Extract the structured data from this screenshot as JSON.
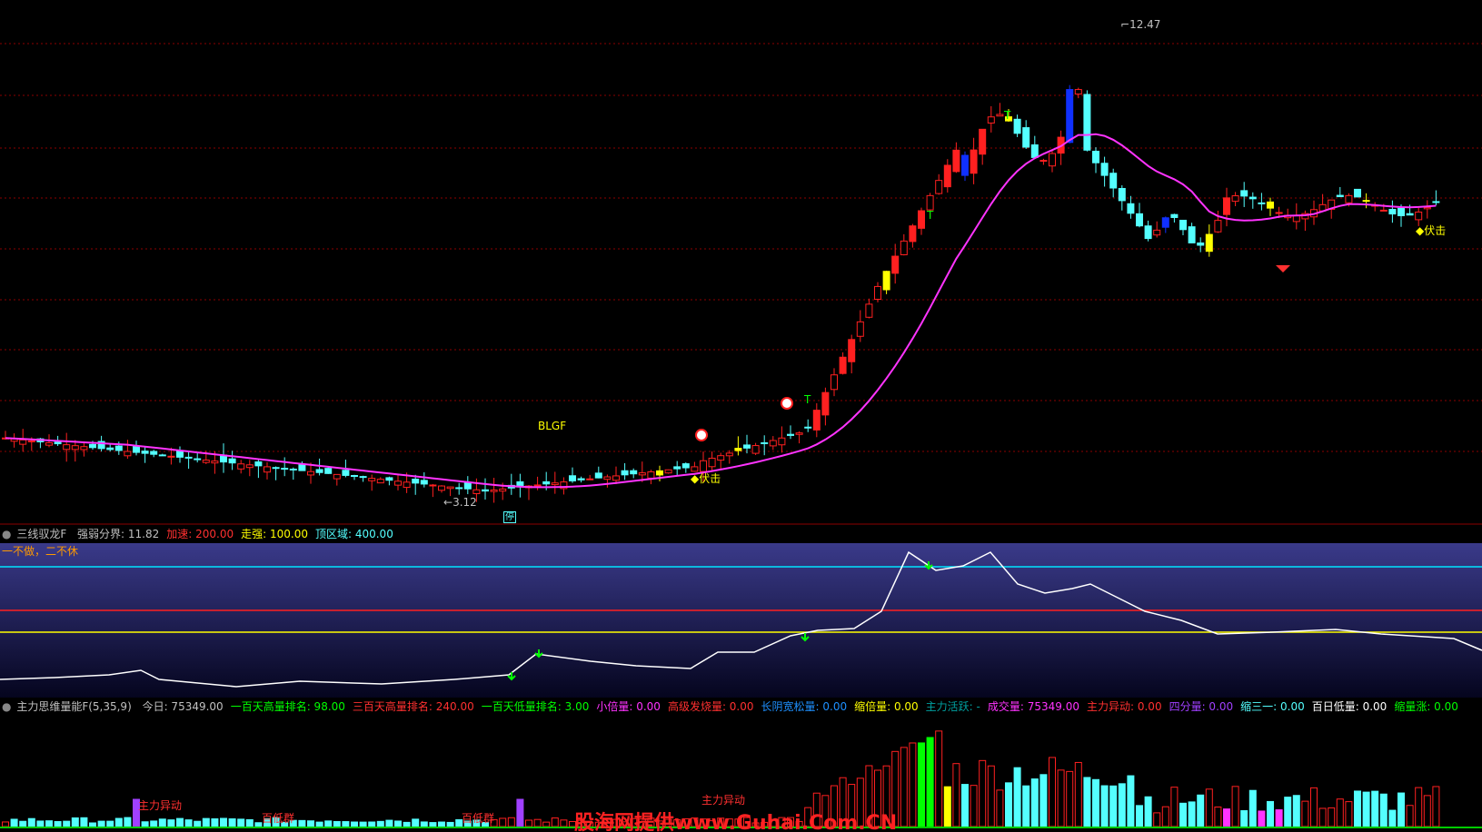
{
  "price_panel": {
    "high_label": "12.47",
    "low_label": "3.12",
    "signals": {
      "blgf": "BLGF",
      "fuji_1": "◆伏击",
      "fuji_2": "◆伏击",
      "t_1": "T",
      "t_2": "T",
      "t_3": "T",
      "mark_ting": "停"
    },
    "colors": {
      "ma_line": "#ff33ff",
      "up_candle": "#ff2020",
      "down_candle": "#54ffff",
      "yellow_candle": "#ffff00",
      "blue_candle": "#1030ff",
      "grid": "#8b0000"
    }
  },
  "oscillator": {
    "name": "三线驭龙F",
    "params": [
      {
        "label": "强弱分界: 11.82",
        "color": "#c0c0c0"
      },
      {
        "label": "加速: 200.00",
        "color": "#ff3030"
      },
      {
        "label": "走强: 100.00",
        "color": "#ffff00"
      },
      {
        "label": "顶区域: 400.00",
        "color": "#54ffff"
      }
    ],
    "note": "一不做，二不休",
    "colors": {
      "line": "#ffffff",
      "cyan": "#00e5ff",
      "red": "#ff2020",
      "yellow": "#ffff00",
      "arrow": "#00ff00"
    }
  },
  "volume": {
    "name": "主力思维量能F(5,35,9)",
    "params": [
      {
        "label": "今日: 75349.00",
        "color": "#c0c0c0"
      },
      {
        "label": "一百天高量排名: 98.00",
        "color": "#00ff00"
      },
      {
        "label": "三百天高量排名: 240.00",
        "color": "#ff3030"
      },
      {
        "label": "一百天低量排名: 3.00",
        "color": "#00ff00"
      },
      {
        "label": "小倍量: 0.00",
        "color": "#ff33ff"
      },
      {
        "label": "高级发烧量: 0.00",
        "color": "#ff3030"
      },
      {
        "label": "长阴宽松量: 0.00",
        "color": "#1e90ff"
      },
      {
        "label": "缩倍量: 0.00",
        "color": "#ffff00"
      },
      {
        "label": "主力活跃: -",
        "color": "#00a0a0"
      },
      {
        "label": "成交量: 75349.00",
        "color": "#ff33ff"
      },
      {
        "label": "主力异动: 0.00",
        "color": "#ff3030"
      },
      {
        "label": "四分量: 0.00",
        "color": "#a040ff"
      },
      {
        "label": "缩三一: 0.00",
        "color": "#54ffff"
      },
      {
        "label": "百日低量: 0.00",
        "color": "#ffffff"
      },
      {
        "label": "缩量涨: 0.00",
        "color": "#00ff00"
      }
    ],
    "annotations": {
      "zhuli_1": "主力异动",
      "zhuli_2": "主力异动",
      "baidi_1": "百低群",
      "baidi_2": "百低群"
    }
  },
  "watermark": "股海网提供www.Guhai.Com.CN"
}
